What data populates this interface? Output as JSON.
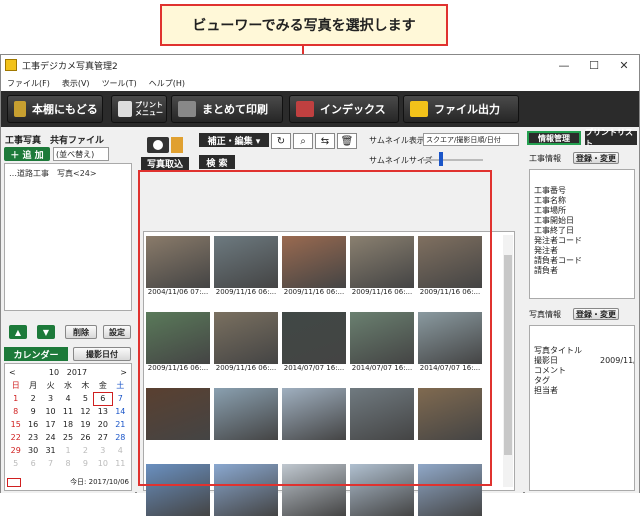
{
  "callout": {
    "text": "ビューワーでみる写真を選択します"
  },
  "window": {
    "title": "工事デジカメ写真管理2",
    "minimize": "—",
    "maximize": "☐",
    "close": "✕"
  },
  "menu": [
    "ファイル(F)",
    "表示(V)",
    "ツール(T)",
    "ヘルプ(H)"
  ],
  "toolbar": {
    "back": "本棚にもどる",
    "print_menu": "プリント\nメニュー",
    "print_all": "まとめて印刷",
    "index": "インデックス",
    "file_output": "ファイル出力"
  },
  "left": {
    "title": "工事写真　共有ファイル",
    "add": "＋ 追 加",
    "sort": "(並べ替え)",
    "tree_item": "…道路工事　写真<24>",
    "up": "▲",
    "down": "▼",
    "delete": "削除",
    "settings": "設定",
    "calendar_tab": "カレンダー",
    "shoot_date_tab": "撮影日付"
  },
  "calendar": {
    "prev": "<",
    "month": "10",
    "year": "2017",
    "next": ">",
    "weekdays": [
      "日",
      "月",
      "火",
      "水",
      "木",
      "金",
      "土"
    ],
    "days": [
      "1",
      "2",
      "3",
      "4",
      "5",
      "6",
      "7",
      "8",
      "9",
      "10",
      "11",
      "12",
      "13",
      "14",
      "15",
      "16",
      "17",
      "18",
      "19",
      "20",
      "21",
      "22",
      "23",
      "24",
      "25",
      "26",
      "27",
      "28",
      "29",
      "30",
      "31",
      "1",
      "2",
      "3",
      "4",
      "5",
      "6",
      "7",
      "8",
      "9",
      "10",
      "11"
    ],
    "today_index": 5,
    "footer": "今日: 2017/10/06"
  },
  "center": {
    "import": "写真取込",
    "edit": "補正・編集 ▾",
    "search": "検 索",
    "rotate_icon": "rotate-icon",
    "zoom_icon": "magnifier-icon",
    "swap_icon": "swap-icon",
    "trash_icon": "trash-icon",
    "thumb_label": "サムネイル表示",
    "thumb_option": "スクエア/撮影日順/日付",
    "size_label": "サムネイルサイズ"
  },
  "thumbs": [
    {
      "cap": "2004/11/06 07:...",
      "color": "#8a7b6a"
    },
    {
      "cap": "2009/11/16 06:...",
      "color": "#6d7a80"
    },
    {
      "cap": "2009/11/16 06:...",
      "color": "#9a6a50"
    },
    {
      "cap": "2009/11/16 06:...",
      "color": "#8a8070"
    },
    {
      "cap": "2009/11/16 06:...",
      "color": "#807060"
    },
    {
      "cap": "2009/11/16 06:...",
      "color": "#5a7a5a"
    },
    {
      "cap": "2009/11/16 06:...",
      "color": "#7a7060"
    },
    {
      "cap": "2014/07/07 16:...",
      "color": "#404845"
    },
    {
      "cap": "2014/07/07 16:...",
      "color": "#6a8070"
    },
    {
      "cap": "2014/07/07 16:...",
      "color": "#8a9aa0"
    },
    {
      "cap": "",
      "color": "#5a4030"
    },
    {
      "cap": "",
      "color": "#8aa0b0"
    },
    {
      "cap": "",
      "color": "#a0b0c0"
    },
    {
      "cap": "",
      "color": "#707a80"
    },
    {
      "cap": "",
      "color": "#806a50"
    },
    {
      "cap": "",
      "color": "#6a90c0"
    },
    {
      "cap": "",
      "color": "#8aa8d0"
    },
    {
      "cap": "",
      "color": "#c0c8d0"
    },
    {
      "cap": "",
      "color": "#b0c0d0"
    },
    {
      "cap": "",
      "color": "#90a8c8"
    }
  ],
  "right": {
    "info_tab": "情報管理",
    "print_tab": "プリントリスト",
    "work_info": "工事情報",
    "register": "登録・変更",
    "work_fields": [
      "工事番号",
      "工事名称",
      "工事場所",
      "工事開始日",
      "工事終了日",
      "発注者コード",
      "発注者",
      "請負者コード",
      "請負者"
    ],
    "photo_info": "写真情報",
    "photo_register": "登録・変更",
    "photo_fields": [
      "写真タイトル",
      "撮影日",
      "コメント",
      "タグ",
      "担当者"
    ],
    "shoot_date_value": "2009/11/"
  }
}
